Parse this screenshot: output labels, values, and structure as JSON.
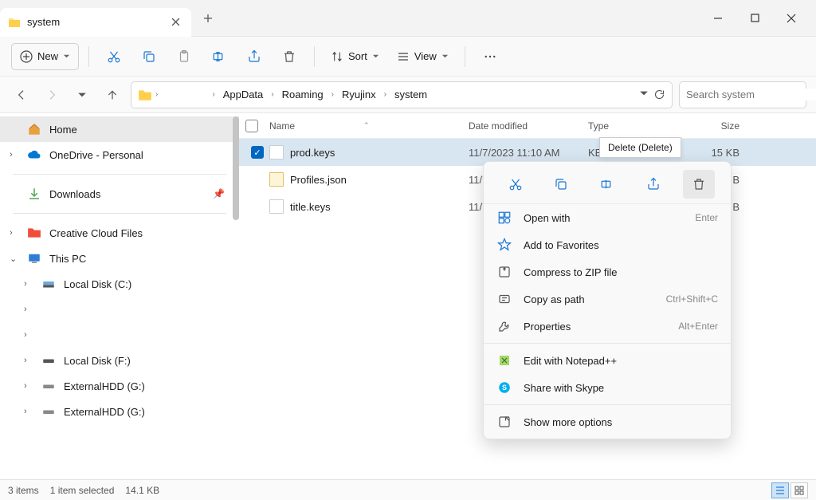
{
  "tab": {
    "title": "system"
  },
  "toolbar": {
    "new_label": "New",
    "sort_label": "Sort",
    "view_label": "View"
  },
  "breadcrumbs": [
    "AppData",
    "Roaming",
    "Ryujinx",
    "system"
  ],
  "search": {
    "placeholder": "Search system"
  },
  "sidebar": {
    "home": "Home",
    "onedrive": "OneDrive - Personal",
    "downloads": "Downloads",
    "creative": "Creative Cloud Files",
    "thispc": "This PC",
    "driveC": "Local Disk (C:)",
    "driveF": "Local Disk (F:)",
    "extG1": "ExternalHDD (G:)",
    "extG2": "ExternalHDD (G:)"
  },
  "columns": {
    "name": "Name",
    "date": "Date modified",
    "type": "Type",
    "size": "Size"
  },
  "files": [
    {
      "name": "prod.keys",
      "date": "11/7/2023 11:10 AM",
      "type": "KEY",
      "size": "15 KB",
      "selected": true
    },
    {
      "name": "Profiles.json",
      "date": "11/7/",
      "type": "",
      "size": "B",
      "selected": false
    },
    {
      "name": "title.keys",
      "date": "11/7/",
      "type": "",
      "size": "B",
      "selected": false
    }
  ],
  "tooltip": "Delete (Delete)",
  "context_menu": {
    "items": [
      {
        "label": "Open with",
        "hint": "Enter",
        "icon": "open-with"
      },
      {
        "label": "Add to Favorites",
        "hint": "",
        "icon": "star"
      },
      {
        "label": "Compress to ZIP file",
        "hint": "",
        "icon": "zip"
      },
      {
        "label": "Copy as path",
        "hint": "Ctrl+Shift+C",
        "icon": "path"
      },
      {
        "label": "Properties",
        "hint": "Alt+Enter",
        "icon": "wrench"
      },
      {
        "label": "Edit with Notepad++",
        "hint": "",
        "icon": "notepad"
      },
      {
        "label": "Share with Skype",
        "hint": "",
        "icon": "skype"
      },
      {
        "label": "Show more options",
        "hint": "",
        "icon": "more"
      }
    ]
  },
  "status": {
    "items": "3 items",
    "selected": "1 item selected",
    "size": "14.1 KB"
  }
}
